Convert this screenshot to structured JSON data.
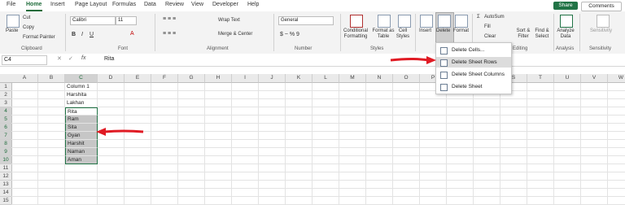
{
  "menu": {
    "items": [
      "File",
      "Home",
      "Insert",
      "Page Layout",
      "Formulas",
      "Data",
      "Review",
      "View",
      "Developer",
      "Help"
    ],
    "share": "Share",
    "comments": "Comments"
  },
  "ribbon": {
    "clipboard": {
      "paste": "Paste",
      "cut": "Cut",
      "copy": "Copy",
      "format_painter": "Format Painter",
      "label": "Clipboard"
    },
    "font": {
      "name": "Calibri",
      "size": "11",
      "label": "Font"
    },
    "alignment": {
      "wrap_text": "Wrap Text",
      "merge_center": "Merge & Center",
      "label": "Alignment"
    },
    "number": {
      "format": "General",
      "label": "Number"
    },
    "styles": {
      "conditional": "Conditional Formatting",
      "format_table": "Format as Table",
      "cell_styles": "Cell Styles",
      "label": "Styles"
    },
    "cells": {
      "insert": "Insert",
      "delete": "Delete",
      "format": "Format"
    },
    "editing": {
      "autosum": "AutoSum",
      "fill": "Fill",
      "clear": "Clear",
      "sort_filter": "Sort & Filter",
      "find_select": "Find & Select",
      "label": "Editing"
    },
    "analysis": {
      "analyze": "Analyze Data",
      "label": "Analysis"
    },
    "sensitivity": {
      "sensitivity": "Sensitivity",
      "label": "Sensitivity"
    }
  },
  "formula_bar": {
    "name_box": "C4",
    "fx": "fx",
    "content": "Rita"
  },
  "grid": {
    "columns": [
      "A",
      "B",
      "C",
      "D",
      "E",
      "F",
      "G",
      "H",
      "I",
      "J",
      "K",
      "L",
      "M",
      "N",
      "O",
      "P",
      "Q",
      "R",
      "S",
      "T",
      "U",
      "V",
      "W"
    ],
    "rows": [
      "1",
      "2",
      "3",
      "4",
      "5",
      "6",
      "7",
      "8",
      "9",
      "10",
      "11",
      "12",
      "13",
      "14",
      "15"
    ],
    "c_values": [
      "Column 1",
      "Harshita",
      "Lakhan",
      "Rita",
      "Ram",
      "Sita",
      "Gyan",
      "Harshit",
      "Naman",
      "Aman"
    ]
  },
  "dropdown": {
    "items": [
      "Delete Cells...",
      "Delete Sheet Rows",
      "Delete Sheet Columns",
      "Delete Sheet"
    ]
  },
  "colors": {
    "accent": "#217346",
    "arrow": "#e01b24",
    "highlight": "#c6c6c6"
  }
}
